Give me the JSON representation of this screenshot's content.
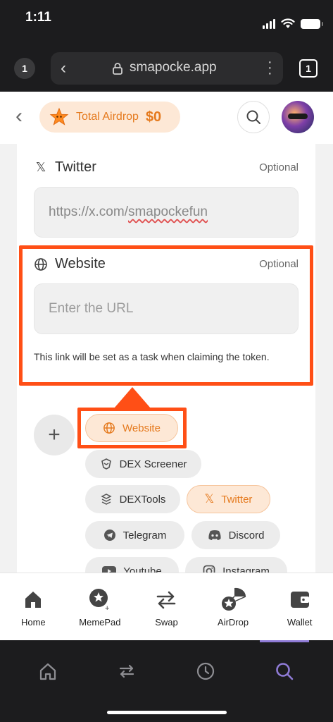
{
  "status_bar": {
    "time": "1:11"
  },
  "browser": {
    "tab_count_left": "1",
    "url": "smapocke.app",
    "tabs_button": "1",
    "toolbar": {
      "buttons": [
        "home-icon",
        "swap-arrows-icon",
        "history-icon",
        "search-icon"
      ],
      "active_color": "#8f7bd6"
    }
  },
  "header": {
    "airdrop_label": "Total Airdrop",
    "airdrop_value": "$0",
    "accent_color": "#e57a1e"
  },
  "form": {
    "twitter": {
      "title": "Twitter",
      "optional": "Optional",
      "value_prefix": "https://x.com/",
      "value_handle": "smapockefun"
    },
    "website": {
      "title": "Website",
      "optional": "Optional",
      "placeholder": "Enter the URL",
      "note": "This link will be set as a task when claiming the token."
    }
  },
  "highlight_color": "#ff4f16",
  "chips": [
    {
      "label": "Website",
      "icon": "globe-icon",
      "active": true
    },
    {
      "label": "DEX Screener",
      "icon": "dexscreener-icon",
      "active": false
    },
    {
      "label": "DEXTools",
      "icon": "dextools-icon",
      "active": false
    },
    {
      "label": "Twitter",
      "icon": "x-logo-icon",
      "active": true
    },
    {
      "label": "Telegram",
      "icon": "telegram-icon",
      "active": false
    },
    {
      "label": "Discord",
      "icon": "discord-icon",
      "active": false
    },
    {
      "label": "Youtube",
      "icon": "youtube-icon",
      "active": false
    },
    {
      "label": "Instagram",
      "icon": "instagram-icon",
      "active": false
    }
  ],
  "nav": [
    {
      "label": "Home",
      "icon": "home-icon"
    },
    {
      "label": "MemePad",
      "icon": "memepad-icon"
    },
    {
      "label": "Swap",
      "icon": "swap-icon"
    },
    {
      "label": "AirDrop",
      "icon": "airdrop-icon"
    },
    {
      "label": "Wallet",
      "icon": "wallet-icon"
    }
  ]
}
